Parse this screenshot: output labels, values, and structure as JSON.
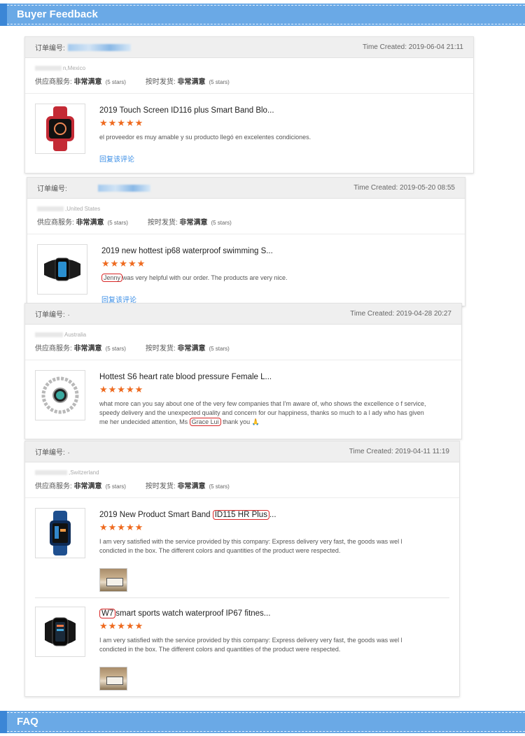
{
  "sections": {
    "feedback_title": "Buyer Feedback",
    "faq_title": "FAQ"
  },
  "labels": {
    "order_no": "订单编号:",
    "supplier_service": "供应商服务:",
    "on_time": "按时发货:",
    "very_satisfied": "非常满意",
    "five_stars": "(5 stars)",
    "reply": "回复该评论",
    "time_created_prefix": "Time Created:"
  },
  "stars": "★★★★★",
  "accent_colors": {
    "bar": "#6aa9e6",
    "bar_edge": "#3b86d6",
    "star": "#ee6a1f",
    "link": "#3a8ee6",
    "highlight": "#d92626"
  },
  "orders": [
    {
      "time": "Time Created: 2019-06-04 21:11",
      "country": "n,Mexico",
      "items": [
        {
          "title": "2019 Touch Screen ID116 plus Smart Band Blo...",
          "comment": "el proveedor es muy amable y su producto llegó en excelentes condiciones.",
          "icon": "red-smartwatch-icon"
        }
      ]
    },
    {
      "time": "Time Created: 2019-05-20 08:55",
      "country": ",United States",
      "items": [
        {
          "title": "2019 new hottest ip68 waterproof swimming S...",
          "comment_highlight": "Jenny",
          "comment_rest": "was very helpful with our order. The products are very nice.",
          "icon": "black-fitness-band-icon"
        }
      ]
    },
    {
      "time": "Time Created: 2019-04-28 20:27",
      "order_suffix": ".",
      "country": "Australia",
      "items": [
        {
          "title": "Hottest S6 heart rate blood pressure Female L...",
          "comment_before": "what more can you say about one of the very few companies that I'm aware of, who shows the excellence o f service, speedy delivery and the unexpected quality and concern for our happiness, thanks so much to a l ady who has given me her undecided attention, Ms",
          "comment_highlight": "Grace Lui",
          "comment_after": "thank you 🙏",
          "icon": "silver-bracelet-watch-icon"
        }
      ]
    },
    {
      "time": "Time Created: 2019-04-11 11:19",
      "order_suffix": ".",
      "country": ",Switzerland",
      "items": [
        {
          "title_before": "2019 New Product Smart Band ",
          "title_highlight": "ID115 HR Plus",
          "title_after": "...",
          "comment": "I am very satisfied with the service provided by this company: Express delivery very fast, the goods was wel l condicted in the box. The different colors and quantities of the product were respected.",
          "icon": "blue-fitness-band-icon"
        },
        {
          "title_highlight": "W7",
          "title_after": "smart sports watch waterproof IP67 fitnes...",
          "comment": "I am very satisfied with the service provided by this company: Express delivery very fast, the goods was wel l condicted in the box. The different colors and quantities of the product were respected.",
          "icon": "black-sports-watch-icon"
        }
      ]
    }
  ]
}
